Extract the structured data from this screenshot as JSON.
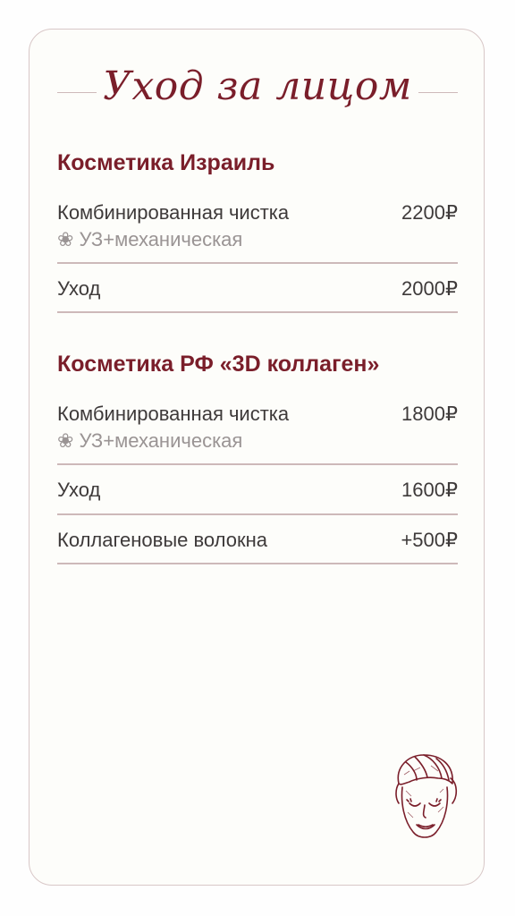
{
  "title": "Уход за лицом",
  "sections": [
    {
      "heading": "Косметика Израиль",
      "items": [
        {
          "name": "Комбинированная чистка",
          "price": "2200₽",
          "note_icon": "❀",
          "note": "УЗ+механическая"
        },
        {
          "name": "Уход",
          "price": "2000₽"
        }
      ]
    },
    {
      "heading": "Косметика РФ «3D коллаген»",
      "items": [
        {
          "name": "Комбинированная чистка",
          "price": "1800₽",
          "note_icon": "❀",
          "note": "УЗ+механическая"
        },
        {
          "name": "Уход",
          "price": "1600₽"
        },
        {
          "name": "Коллагеновые волокна",
          "price": "+500₽"
        }
      ]
    }
  ],
  "decor": {
    "illustration": "face-mask-towel-icon",
    "accent_color": "#7a1e2a",
    "border_color": "#d8c7c7"
  }
}
